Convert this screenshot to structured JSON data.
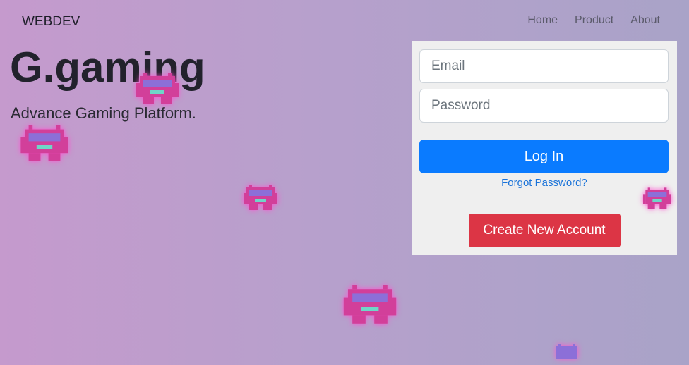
{
  "navbar": {
    "brand": "WEBDEV",
    "links": [
      "Home",
      "Product",
      "About"
    ]
  },
  "hero": {
    "title": "G.gaming",
    "subtitle": "Advance Gaming Platform."
  },
  "login": {
    "email_placeholder": "Email",
    "password_placeholder": "Password",
    "login_label": "Log In",
    "forgot_label": "Forgot Password?",
    "create_label": "Create New Account"
  },
  "colors": {
    "login_button": "#0a7bff",
    "create_button": "#dc3545",
    "link": "#1a73d9"
  },
  "decorations": {
    "icon": "space-invader-icon"
  }
}
